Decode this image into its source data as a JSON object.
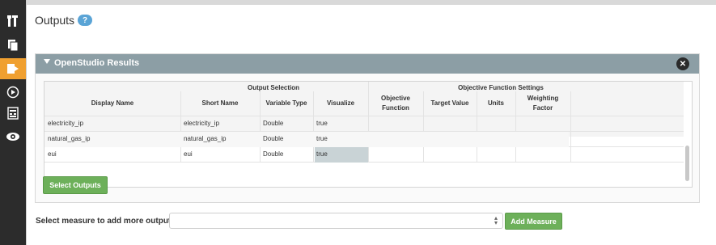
{
  "page": {
    "title": "Outputs",
    "help_glyph": "?"
  },
  "sidebar": {
    "items": [
      {
        "icon": "tools-icon"
      },
      {
        "icon": "documents-icon"
      },
      {
        "icon": "measures-icon",
        "active": true
      },
      {
        "icon": "run-icon"
      },
      {
        "icon": "results-icon"
      },
      {
        "icon": "cloud-icon"
      }
    ],
    "active_color": "#f0a030"
  },
  "panel": {
    "title": "OpenStudio Results",
    "close_glyph": "✕",
    "header_color": "#8c9ea5",
    "groups": {
      "output_selection": "Output Selection",
      "objective_settings": "Objective Function Settings"
    },
    "columns": {
      "display_name": "Display Name",
      "short_name": "Short Name",
      "variable_type": "Variable Type",
      "visualize": "Visualize",
      "objective_function_1": "Objective",
      "objective_function_2": "Function",
      "target_value": "Target Value",
      "units": "Units",
      "weighting_factor_1": "Weighting",
      "weighting_factor_2": "Factor"
    },
    "rows": [
      {
        "display_name": "electricity_ip",
        "short_name": "electricity_ip",
        "variable_type": "Double",
        "visualize": "true"
      },
      {
        "display_name": "natural_gas_ip",
        "short_name": "natural_gas_ip",
        "variable_type": "Double",
        "visualize": "true"
      },
      {
        "display_name": "eui",
        "short_name": "eui",
        "variable_type": "Double",
        "visualize": "true"
      }
    ],
    "select_outputs_label": "Select Outputs"
  },
  "footer": {
    "label": "Select measure to add more outputs",
    "select_value": "",
    "add_measure_label": "Add Measure"
  },
  "colors": {
    "button_green": "#6db05a",
    "help_blue": "#5aa4d6"
  }
}
